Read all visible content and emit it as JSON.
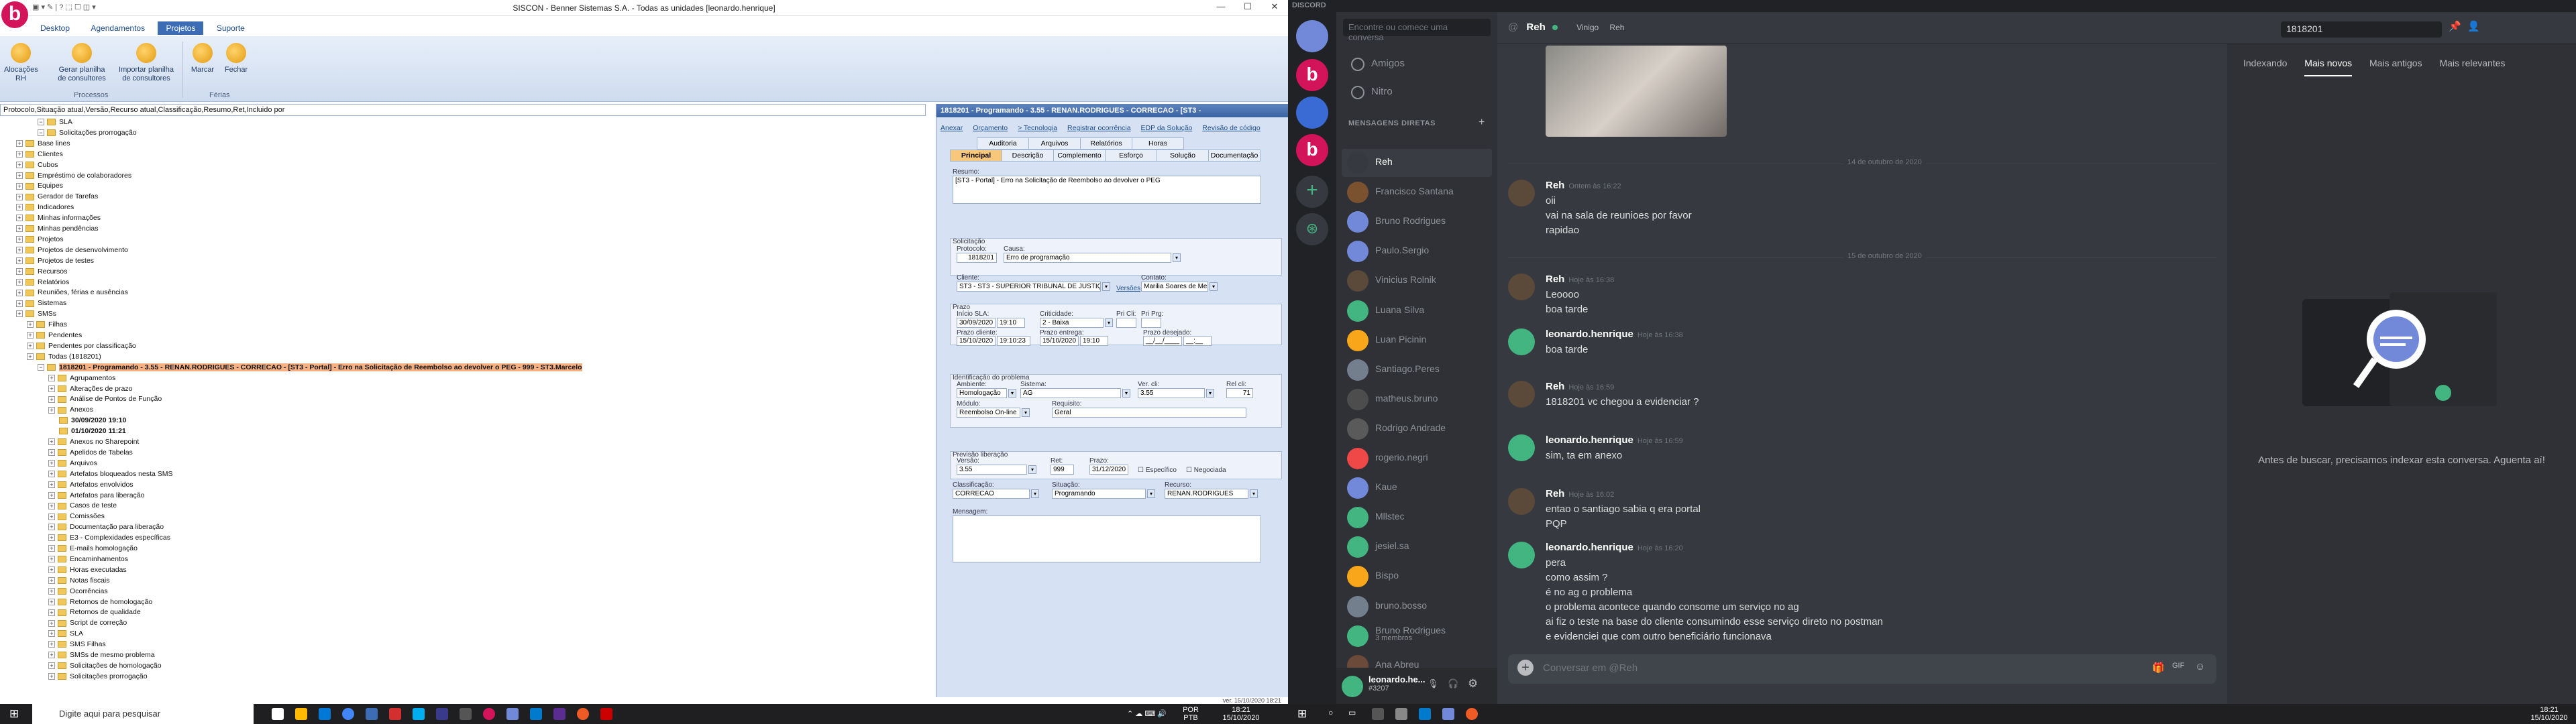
{
  "siscon": {
    "title": "SISCON - Benner Sistemas S.A. - Todas as unidades [leonardo.henrique]",
    "menu": [
      "Desktop",
      "Agendamentos",
      "Projetos",
      "Suporte"
    ],
    "ribbon_buttons": [
      "Alocações RH",
      "Gerar planilha de consultores",
      "Importar planilha de consultores",
      "Marcar",
      "Fechar"
    ],
    "ribbon_groups": [
      "Processos",
      "Férias"
    ],
    "filter": "Protocolo,Situação atual,Versão,Recurso atual,Classificação,Resumo,Ret,Incluido por",
    "tree": [
      {
        "t": "SLA",
        "l": 3
      },
      {
        "t": "Solicitações prorrogação",
        "l": 3
      },
      {
        "t": "Base lines",
        "l": 1
      },
      {
        "t": "Clientes",
        "l": 1
      },
      {
        "t": "Cubos",
        "l": 1
      },
      {
        "t": "Empréstimo de colaboradores",
        "l": 1
      },
      {
        "t": "Equipes",
        "l": 1
      },
      {
        "t": "Gerador de Tarefas",
        "l": 1
      },
      {
        "t": "Indicadores",
        "l": 1
      },
      {
        "t": "Minhas informações",
        "l": 1
      },
      {
        "t": "Minhas pendências",
        "l": 1
      },
      {
        "t": "Projetos",
        "l": 1
      },
      {
        "t": "Projetos de desenvolvimento",
        "l": 1
      },
      {
        "t": "Projetos de testes",
        "l": 1
      },
      {
        "t": "Recursos",
        "l": 1
      },
      {
        "t": "Relatórios",
        "l": 1
      },
      {
        "t": "Reuniões, férias e ausências",
        "l": 1
      },
      {
        "t": "Sistemas",
        "l": 1
      },
      {
        "t": "SMSs",
        "l": 1
      },
      {
        "t": "Filhas",
        "l": 2
      },
      {
        "t": "Pendentes",
        "l": 2
      },
      {
        "t": "Pendentes por classificação",
        "l": 2
      },
      {
        "t": "Todas (1818201)",
        "l": 2
      },
      {
        "t": "1818201 - Programando - 3.55 - RENAN.RODRIGUES - CORRECAO - [ST3 - Portal] - Erro na Solicitação de Reembolso ao devolver o PEG - 999 - ST3.Marcelo",
        "l": 3,
        "hl": true
      },
      {
        "t": "Agrupamentos",
        "l": 4
      },
      {
        "t": "Alterações de prazo",
        "l": 4
      },
      {
        "t": "Análise de Pontos de Função",
        "l": 4
      },
      {
        "t": "Anexos",
        "l": 4
      },
      {
        "t": "30/09/2020 19:10",
        "l": 5,
        "b": true
      },
      {
        "t": "01/10/2020 11:21",
        "l": 5,
        "b": true
      },
      {
        "t": "Anexos no Sharepoint",
        "l": 4
      },
      {
        "t": "Apelidos de Tabelas",
        "l": 4
      },
      {
        "t": "Arquivos",
        "l": 4
      },
      {
        "t": "Artefatos bloqueados nesta SMS",
        "l": 4
      },
      {
        "t": "Artefatos envolvidos",
        "l": 4
      },
      {
        "t": "Artefatos para liberação",
        "l": 4
      },
      {
        "t": "Casos de teste",
        "l": 4
      },
      {
        "t": "Comissões",
        "l": 4
      },
      {
        "t": "Documentação para liberação",
        "l": 4
      },
      {
        "t": "E3 - Complexidades específicas",
        "l": 4
      },
      {
        "t": "E-mails homologação",
        "l": 4
      },
      {
        "t": "Encaminhamentos",
        "l": 4
      },
      {
        "t": "Horas executadas",
        "l": 4
      },
      {
        "t": "Notas fiscais",
        "l": 4
      },
      {
        "t": "Ocorrências",
        "l": 4
      },
      {
        "t": "Retornos de homologação",
        "l": 4
      },
      {
        "t": "Retornos de qualidade",
        "l": 4
      },
      {
        "t": "Script de correção",
        "l": 4
      },
      {
        "t": "SLA",
        "l": 4
      },
      {
        "t": "SMS Filhas",
        "l": 4
      },
      {
        "t": "SMSs de mesmo problema",
        "l": 4
      },
      {
        "t": "Solicitações de homologação",
        "l": 4
      },
      {
        "t": "Solicitações prorrogação",
        "l": 4
      }
    ],
    "detail": {
      "header": "1818201 - Programando - 3.55 - RENAN.RODRIGUES - CORRECAO - [ST3 -",
      "links": [
        "Anexar",
        "Orçamento",
        "> Tecnologia",
        "Registrar ocorrência",
        "EDP da Solução",
        "Revisão de código"
      ],
      "tabs_top": [
        "Auditoria",
        "Arquivos",
        "Relatórios",
        "Horas"
      ],
      "tabs": [
        "Principal",
        "Descrição",
        "Complemento",
        "Esforço",
        "Solução",
        "Documentação"
      ],
      "resumo_label": "Resumo:",
      "resumo": "[ST3 - Portal] - Erro na Solicitação de Reembolso ao devolver o PEG",
      "sol_label": "Solicitação",
      "protocolo_label": "Protocolo:",
      "protocolo": "1818201",
      "causa_label": "Causa:",
      "causa": "Erro de programação",
      "cliente_label": "Cliente:",
      "cliente": "ST3 - ST3 - SUPERIOR TRIBUNAL DE JUSTIÇA",
      "versoes": "Versões",
      "contato_label": "Contato:",
      "contato": "Marilia Soares de Melo C",
      "prazo_label": "Prazo",
      "inicio_label": "Início SLA:",
      "inicio": "30/09/2020",
      "inicio_h": "19:10",
      "crit_label": "Criticidade:",
      "crit": "2 - Baixa",
      "prcli_label": "Pri Cli:",
      "prprg_label": "Pri Prg:",
      "pcli_label": "Prazo cliente:",
      "pcli": "15/10/2020",
      "pcli_h": "19:10:23",
      "pent_label": "Prazo entrega:",
      "pent": "15/10/2020",
      "pent_h": "19:10",
      "pdes_label": "Prazo desejado:",
      "pdes": "__/__/____",
      "pdes_h": "__:__",
      "ident_label": "Identificação do problema",
      "amb_label": "Ambiente:",
      "amb": "Homologação",
      "sis_label": "Sistema:",
      "sis": "AG",
      "ver_label": "Ver. cli:",
      "ver": "3.55",
      "rel_label": "Rel cli:",
      "rel": "71",
      "mod_label": "Módulo:",
      "mod": "Reembolso On-line",
      "req_label": "Requisito:",
      "req": "Geral",
      "prev_label": "Previsão liberação",
      "versao_label": "Versão:",
      "versao": "3.55",
      "ret_label": "Ret:",
      "ret": "999",
      "prazo2_label": "Prazo:",
      "prazo2": "31/12/2020",
      "esp": "Específico",
      "neg": "Negociada",
      "clas_label": "Classificação:",
      "clas": "CORRECAO",
      "sit_label": "Situação:",
      "sit": "Programando",
      "rec_label": "Recurso:",
      "rec": "RENAN.RODRIGUES",
      "msg_label": "Mensagem:",
      "status": "ver. 15/10/2020 18:21"
    }
  },
  "taskbar1": {
    "search": "Digite aqui para pesquisar",
    "lang": "POR PTB",
    "time": "18:21",
    "date": "15/10/2020"
  },
  "taskbar2": {
    "time": "18:21",
    "date": "15/10/2020"
  },
  "discord": {
    "brand": "DISCORD",
    "search_placeholder": "Encontre ou comece uma conversa",
    "nav": [
      "Amigos",
      "Nitro"
    ],
    "dm_header": "MENSAGENS DIRETAS",
    "dms": [
      {
        "n": "Reh",
        "c": "#36393f",
        "act": true
      },
      {
        "n": "Francisco Santana",
        "c": "#7a5230"
      },
      {
        "n": "Bruno Rodrigues",
        "c": "#7289da"
      },
      {
        "n": "Paulo.Sergio",
        "c": "#7289da"
      },
      {
        "n": "Vinicius Rolnik",
        "c": "#5b4a3a"
      },
      {
        "n": "Luana Silva",
        "c": "#43b581"
      },
      {
        "n": "Luan Picinin",
        "c": "#faa61a"
      },
      {
        "n": "Santiago.Peres",
        "c": "#747f8d"
      },
      {
        "n": "matheus.bruno",
        "c": "#4d4d4d"
      },
      {
        "n": "Rodrigo Andrade",
        "c": "#5a5a5a"
      },
      {
        "n": "rogerio.negri",
        "c": "#f04747"
      },
      {
        "n": "Kaue",
        "c": "#7289da"
      },
      {
        "n": "Mllstec",
        "c": "#43b581"
      },
      {
        "n": "jesiel.sa",
        "c": "#43b581"
      },
      {
        "n": "Bispo",
        "c": "#faa61a"
      },
      {
        "n": "bruno.bosso",
        "c": "#747f8d"
      },
      {
        "n": "Bruno Rodrigues",
        "c": "#43b581",
        "sub": "3 membros"
      },
      {
        "n": "Ana Abreu",
        "c": "#6b4a3a"
      }
    ],
    "user": {
      "name": "leonardo.he...",
      "tag": "#3207"
    },
    "chat": {
      "channel": "Reh",
      "status1": "Vinigo",
      "status2": "Reh",
      "dividers": [
        "14 de outubro de 2020",
        "15 de outubro de 2020"
      ],
      "messages": [
        {
          "u": "Reh",
          "t": "Ontem às 16:22",
          "lines": [
            "oii",
            "vai na sala de reunioes por favor",
            "rapidao"
          ],
          "c": "#5b4a3a"
        },
        {
          "u": "Reh",
          "t": "Hoje às 16:38",
          "lines": [
            "Leoooo",
            "boa tarde"
          ],
          "c": "#5b4a3a"
        },
        {
          "u": "leonardo.henrique",
          "t": "Hoje às 16:38",
          "lines": [
            "boa tarde"
          ],
          "c": "#43b581"
        },
        {
          "u": "Reh",
          "t": "Hoje às 16:59",
          "lines": [
            "1818201 vc chegou a evidenciar ?"
          ],
          "c": "#5b4a3a"
        },
        {
          "u": "leonardo.henrique",
          "t": "Hoje às 16:59",
          "lines": [
            "sim, ta em anexo"
          ],
          "c": "#43b581"
        },
        {
          "u": "Reh",
          "t": "Hoje às 16:02",
          "lines": [
            "entao o santiago sabia q era portal",
            "PQP"
          ],
          "c": "#5b4a3a"
        },
        {
          "u": "leonardo.henrique",
          "t": "Hoje às 16:20",
          "lines": [
            "pera",
            "como assim ?",
            "é no ag o problema",
            "o problema acontece quando consome um serviço no ag",
            "ai fiz o teste na base do cliente consumindo esse serviço direto no postman",
            "e evidenciei que com outro beneficiário funcionava"
          ],
          "c": "#43b581"
        }
      ],
      "input_placeholder": "Conversar em @Reh"
    },
    "header_search": "1818201",
    "search_panel": {
      "tabs": [
        "Indexando",
        "Mais novos",
        "Mais antigos",
        "Mais relevantes"
      ],
      "text": "Antes de buscar, precisamos indexar esta conversa. Aguenta aí!"
    }
  }
}
